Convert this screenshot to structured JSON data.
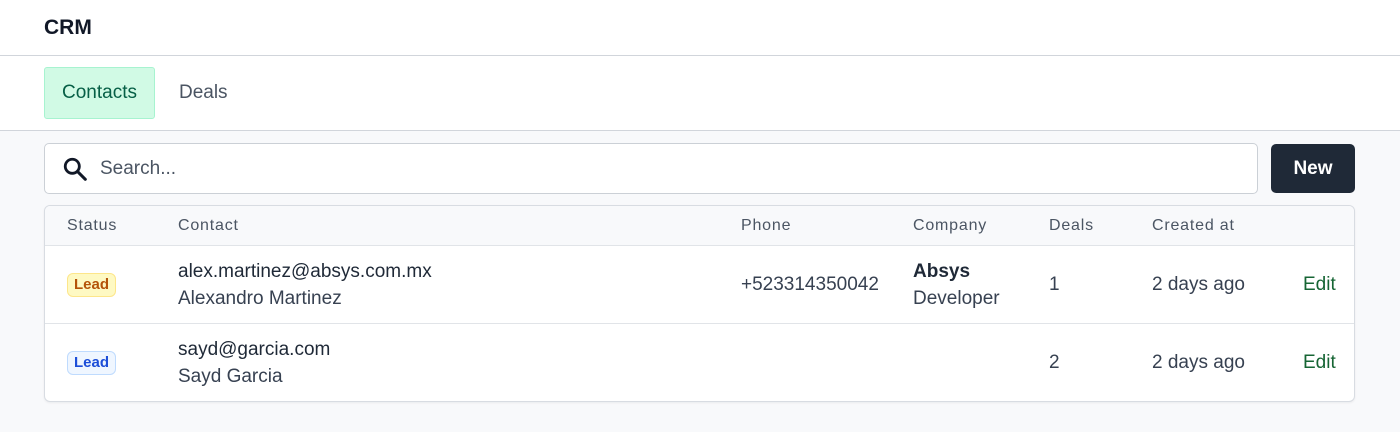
{
  "app": {
    "title": "CRM"
  },
  "tabs": [
    {
      "label": "Contacts",
      "active": true
    },
    {
      "label": "Deals",
      "active": false
    }
  ],
  "search": {
    "placeholder": "Search...",
    "icon": "search-icon"
  },
  "toolbar": {
    "new_label": "New"
  },
  "table": {
    "headers": {
      "status": "Status",
      "contact": "Contact",
      "phone": "Phone",
      "company": "Company",
      "deals": "Deals",
      "created": "Created at"
    },
    "rows": [
      {
        "status": "Lead",
        "status_color": "#b45309",
        "email": "alex.martinez@absys.com.mx",
        "name": "Alexandro Martinez",
        "phone": "+523314350042",
        "company": "Absys",
        "role": "Developer",
        "deals": "1",
        "created": "2 days ago",
        "action": "Edit"
      },
      {
        "status": "Lead",
        "status_color": "#1d4ed8",
        "email": "sayd@garcia.com",
        "name": "Sayd Garcia",
        "phone": "",
        "company": "",
        "role": "",
        "deals": "2",
        "created": "2 days ago",
        "action": "Edit"
      }
    ]
  },
  "colors": {
    "active_tab_bg": "#d1fae5",
    "primary_button": "#1f2937",
    "edit_link": "#166534"
  }
}
